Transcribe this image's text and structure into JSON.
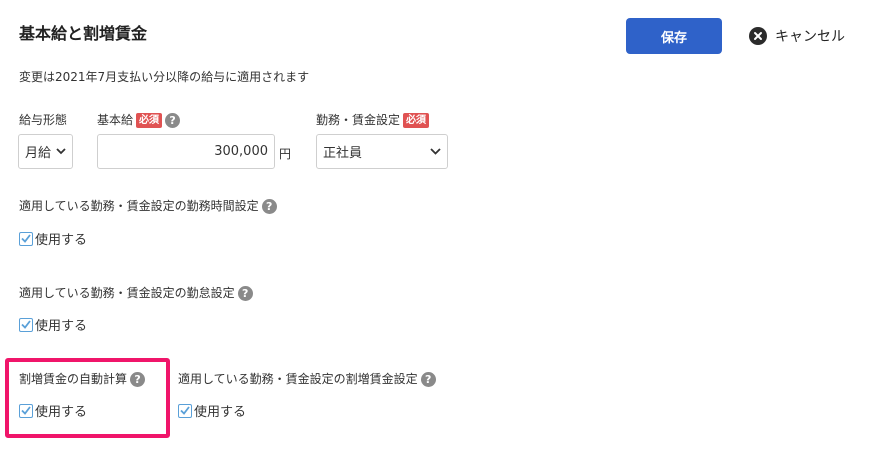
{
  "header": {
    "title": "基本給と割増賃金",
    "save_label": "保存",
    "cancel_label": "キャンセル"
  },
  "notice": "変更は2021年7月支払い分以降の給与に適用されます",
  "form": {
    "pay_type": {
      "label": "給与形態",
      "value": "月給"
    },
    "base_salary": {
      "label": "基本給",
      "required_badge": "必須",
      "value": "300,000",
      "unit": "円"
    },
    "work_setting": {
      "label": "勤務・賃金設定",
      "required_badge": "必須",
      "value": "正社員"
    }
  },
  "settings": {
    "work_hours": {
      "label": "適用している勤務・賃金設定の勤務時間設定",
      "checkbox_label": "使用する",
      "checked": true
    },
    "attendance": {
      "label": "適用している勤務・賃金設定の勤怠設定",
      "checkbox_label": "使用する",
      "checked": true
    },
    "auto_overtime": {
      "label": "割増賃金の自動計算",
      "checkbox_label": "使用する",
      "checked": true
    },
    "overtime_setting": {
      "label": "適用している勤務・賃金設定の割増賃金設定",
      "checkbox_label": "使用する",
      "checked": true
    }
  },
  "help_glyph": "?",
  "colors": {
    "primary": "#2f62c9",
    "required": "#e05252",
    "highlight": "#f0156a",
    "checkbox": "#5aa0d8"
  }
}
